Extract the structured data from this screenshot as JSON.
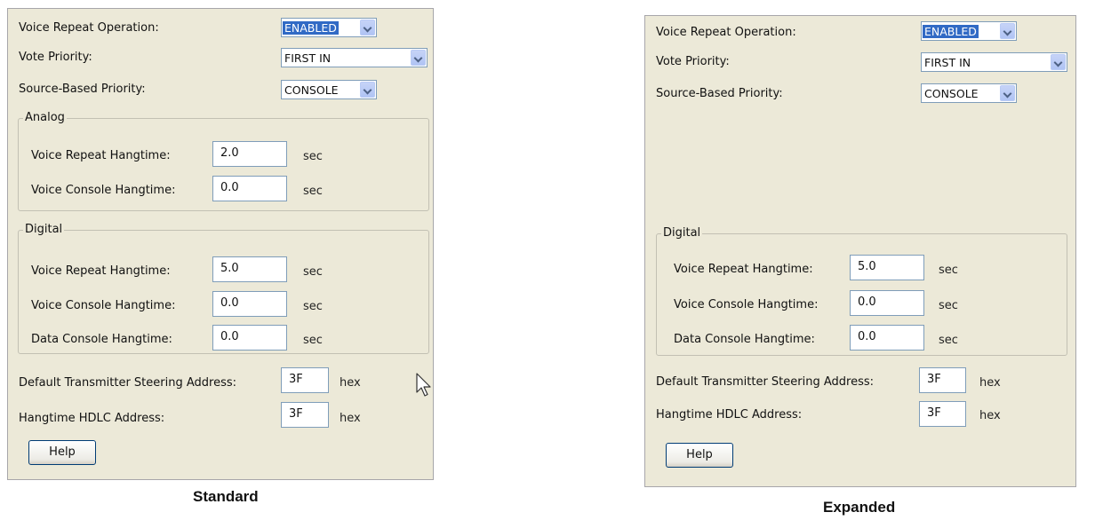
{
  "labels": {
    "voice_repeat_operation": "Voice Repeat Operation:",
    "vote_priority": "Vote Priority:",
    "source_based_priority": "Source-Based Priority:",
    "analog": "Analog",
    "digital": "Digital",
    "voice_repeat_hangtime": "Voice Repeat Hangtime:",
    "voice_console_hangtime": "Voice Console Hangtime:",
    "data_console_hangtime": "Data Console Hangtime:",
    "default_tx_steering": "Default Transmitter Steering Address:",
    "hangtime_hdlc": "Hangtime HDLC Address:",
    "sec": "sec",
    "hex": "hex",
    "help": "Help"
  },
  "standard": {
    "caption": "Standard",
    "voice_repeat_operation": "ENABLED",
    "vote_priority": "FIRST IN",
    "source_based_priority": "CONSOLE",
    "analog": {
      "voice_repeat_hangtime": "2.0",
      "voice_console_hangtime": "0.0"
    },
    "digital": {
      "voice_repeat_hangtime": "5.0",
      "voice_console_hangtime": "0.0",
      "data_console_hangtime": "0.0"
    },
    "default_tx_steering": "3F",
    "hangtime_hdlc": "3F"
  },
  "expanded": {
    "caption": "Expanded",
    "voice_repeat_operation": "ENABLED",
    "vote_priority": "FIRST IN",
    "source_based_priority": "CONSOLE",
    "digital": {
      "voice_repeat_hangtime": "5.0",
      "voice_console_hangtime": "0.0",
      "data_console_hangtime": "0.0"
    },
    "default_tx_steering": "3F",
    "hangtime_hdlc": "3F"
  }
}
